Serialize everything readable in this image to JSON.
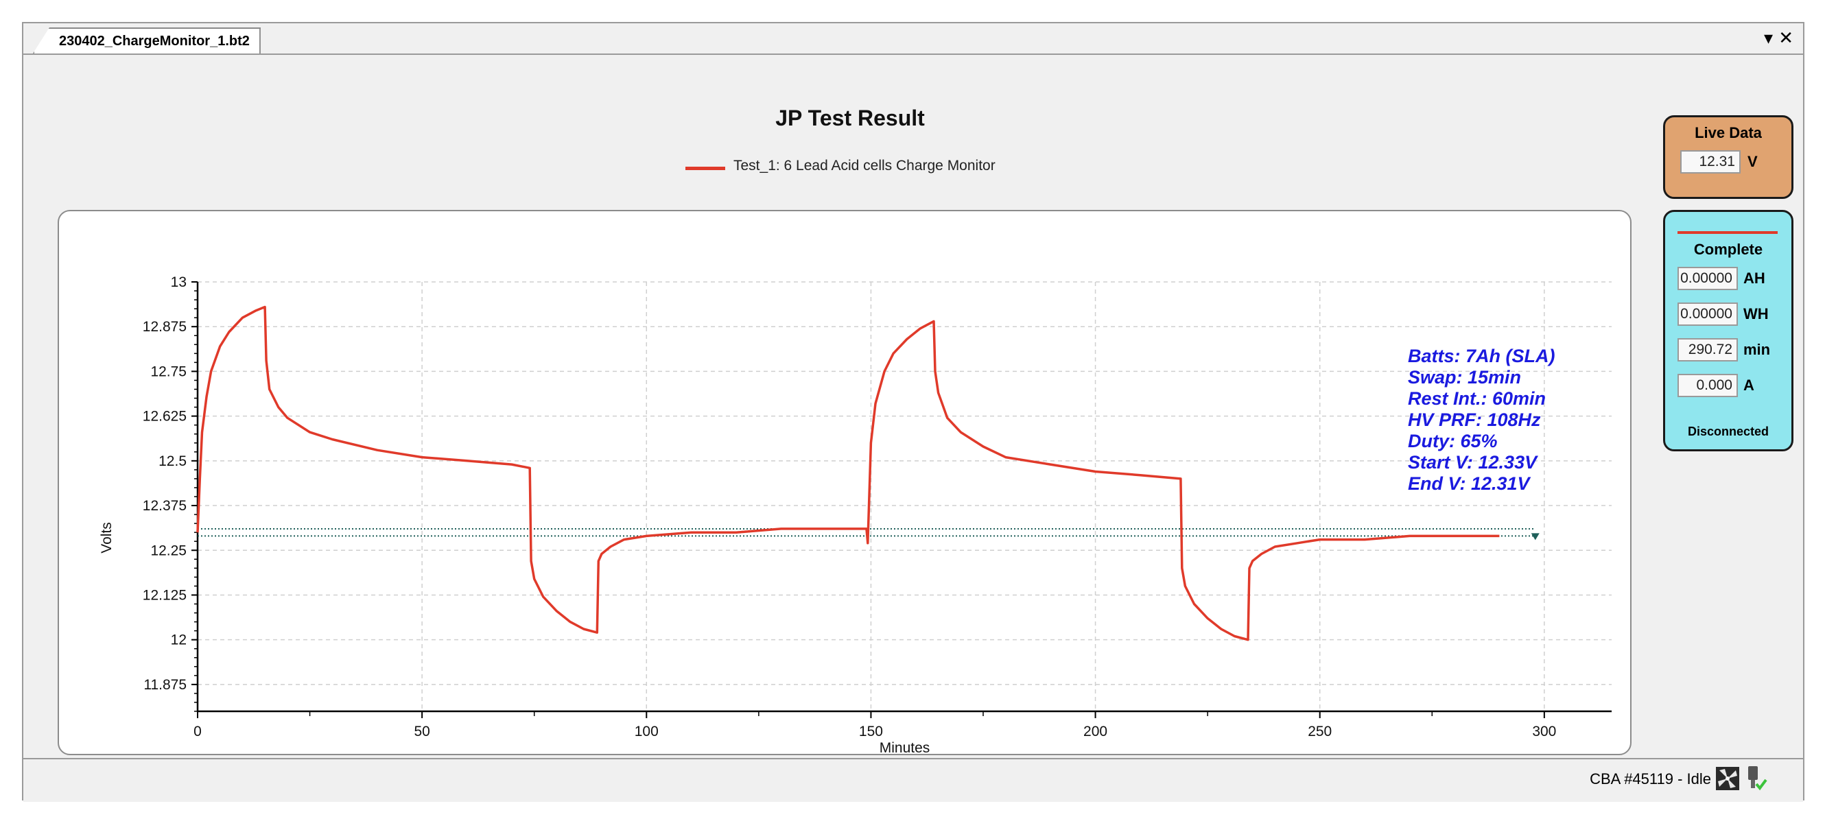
{
  "window": {
    "tab_title": "230402_ChargeMonitor_1.bt2",
    "dropdown_icon": "chevron-down-icon",
    "close_icon": "close-icon"
  },
  "chart": {
    "title": "JP Test Result",
    "legend_label": "Test_1: 6 Lead Acid cells Charge Monitor",
    "line_color": "#e03a2a"
  },
  "annotations": [
    "Batts: 7Ah (SLA)",
    "Swap: 15min",
    "Rest Int.: 60min",
    "HV PRF: 108Hz",
    "Duty: 65%",
    "Start V: 12.33V",
    "End V: 12.31V"
  ],
  "live_data": {
    "title": "Live Data",
    "value": "12.31",
    "unit": "V",
    "color": "#e0a370"
  },
  "status_panel": {
    "title": "Complete",
    "color": "#90e6ee",
    "rows": [
      {
        "value": "0.00000",
        "unit": "AH"
      },
      {
        "value": "0.00000",
        "unit": "WH"
      },
      {
        "value": "290.72",
        "unit": "min"
      },
      {
        "value": "0.000",
        "unit": "A"
      }
    ],
    "connection": "Disconnected"
  },
  "statusbar": {
    "text": "CBA #45119 - Idle",
    "fan_icon": "fan-icon",
    "plug_icon": "plug-icon"
  },
  "chart_data": {
    "type": "line",
    "xlabel": "Minutes",
    "ylabel": "Volts",
    "xlim": [
      0,
      315
    ],
    "ylim": [
      11.8,
      13
    ],
    "xticks": [
      0,
      50,
      100,
      150,
      200,
      250,
      300
    ],
    "xtick_labels": [
      "0",
      "50",
      "100",
      "150",
      "200",
      "250",
      "300"
    ],
    "yticks": [
      11.875,
      12,
      12.125,
      12.25,
      12.375,
      12.5,
      12.625,
      12.75,
      12.875,
      13
    ],
    "ytick_labels": [
      "11.875",
      "12",
      "12.125",
      "12.25",
      "12.375",
      "12.5",
      "12.625",
      "12.75",
      "12.875",
      "13"
    ],
    "grid": true,
    "reference_lines": [
      12.31,
      12.29
    ],
    "series": [
      {
        "name": "Test_1: 6 Lead Acid cells Charge Monitor",
        "x": [
          0,
          0.5,
          1,
          2,
          3,
          5,
          7,
          10,
          13,
          15,
          15.3,
          16,
          18,
          20,
          25,
          30,
          40,
          50,
          60,
          70,
          74,
          74.3,
          75,
          77,
          80,
          83,
          86,
          89,
          89.3,
          90,
          92,
          95,
          100,
          110,
          120,
          130,
          140,
          148,
          149,
          149.3,
          150,
          151,
          153,
          155,
          158,
          161,
          164,
          164.3,
          165,
          167,
          170,
          175,
          180,
          190,
          200,
          210,
          219,
          219.3,
          220,
          222,
          225,
          228,
          231,
          234,
          234.3,
          235,
          237,
          240,
          245,
          250,
          260,
          270,
          280,
          290
        ],
        "y": [
          12.3,
          12.45,
          12.58,
          12.68,
          12.75,
          12.82,
          12.86,
          12.9,
          12.92,
          12.93,
          12.78,
          12.7,
          12.65,
          12.62,
          12.58,
          12.56,
          12.53,
          12.51,
          12.5,
          12.49,
          12.48,
          12.22,
          12.17,
          12.12,
          12.08,
          12.05,
          12.03,
          12.02,
          12.22,
          12.24,
          12.26,
          12.28,
          12.29,
          12.3,
          12.3,
          12.31,
          12.31,
          12.31,
          12.31,
          12.27,
          12.55,
          12.66,
          12.75,
          12.8,
          12.84,
          12.87,
          12.89,
          12.75,
          12.69,
          12.62,
          12.58,
          12.54,
          12.51,
          12.49,
          12.47,
          12.46,
          12.45,
          12.2,
          12.15,
          12.1,
          12.06,
          12.03,
          12.01,
          12.0,
          12.2,
          12.22,
          12.24,
          12.26,
          12.27,
          12.28,
          12.28,
          12.29,
          12.29,
          12.29
        ]
      }
    ]
  }
}
